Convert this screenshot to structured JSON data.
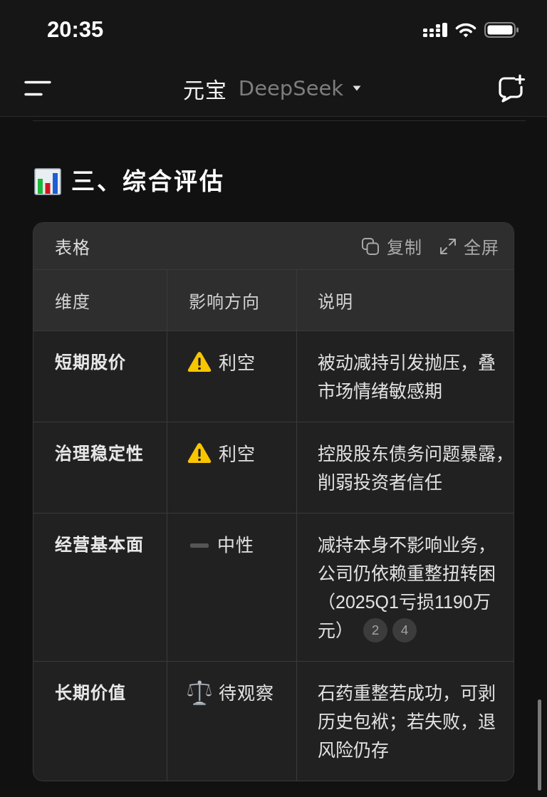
{
  "status_bar": {
    "time": "20:35"
  },
  "header": {
    "title": "元宝",
    "model": "DeepSeek"
  },
  "section": {
    "heading": "三、综合评估"
  },
  "table": {
    "label": "表格",
    "actions": [
      {
        "kind": "copy",
        "label": "复制"
      },
      {
        "kind": "fullscreen",
        "label": "全屏"
      }
    ],
    "columns": [
      "维度",
      "影响方向",
      "说明"
    ],
    "rows": [
      {
        "dimension": "短期股价",
        "direction": {
          "kind": "warning",
          "label": "利空"
        },
        "note_lines": [
          "被动减持引发抛压，叠",
          "市场情绪敏感期"
        ]
      },
      {
        "dimension": "治理稳定性",
        "direction": {
          "kind": "warning",
          "label": "利空"
        },
        "note_lines": [
          "控股股东债务问题暴露，",
          "削弱投资者信任"
        ]
      },
      {
        "dimension": "经营基本面",
        "direction": {
          "kind": "neutral",
          "label": "中性"
        },
        "note_lines": [
          "减持本身不影响业务，",
          "公司仍依赖重整扭转困",
          "（2025Q1亏损1190万",
          "元）"
        ],
        "refs": [
          "2",
          "4"
        ]
      },
      {
        "dimension": "长期价值",
        "direction": {
          "kind": "scales",
          "label": "待观察"
        },
        "note_lines": [
          "石药重整若成功，可剥",
          "历史包袱；若失败，退",
          "风险仍存"
        ]
      }
    ]
  }
}
